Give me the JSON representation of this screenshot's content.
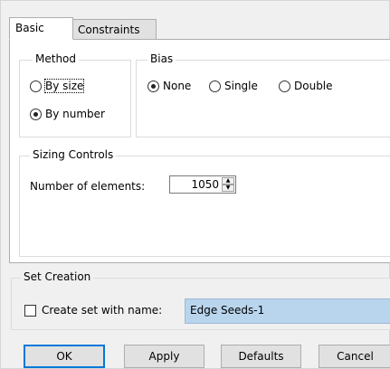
{
  "tabs": [
    {
      "label": "Basic",
      "active": true
    },
    {
      "label": "Constraints",
      "active": false
    }
  ],
  "method": {
    "legend": "Method",
    "options": [
      {
        "label": "By size",
        "checked": false
      },
      {
        "label": "By number",
        "checked": true
      }
    ]
  },
  "bias": {
    "legend": "Bias",
    "options": [
      {
        "label": "None",
        "checked": true
      },
      {
        "label": "Single",
        "checked": false
      },
      {
        "label": "Double",
        "checked": false
      }
    ]
  },
  "sizing": {
    "legend": "Sizing Controls",
    "number_label": "Number of elements:",
    "number_value": "1050"
  },
  "set_creation": {
    "legend": "Set Creation",
    "checkbox_label": "Create set with name:",
    "checked": false,
    "name_value": "Edge Seeds-1"
  },
  "buttons": {
    "ok": "OK",
    "apply": "Apply",
    "defaults": "Defaults",
    "cancel": "Cancel"
  },
  "colors": {
    "selection_fill": "#b9d5ee",
    "dialog_bg": "#f0f0f0",
    "default_button_border": "#0078d7"
  },
  "icons": {
    "spinner_up": "up-triangle",
    "spinner_down": "down-triangle"
  }
}
